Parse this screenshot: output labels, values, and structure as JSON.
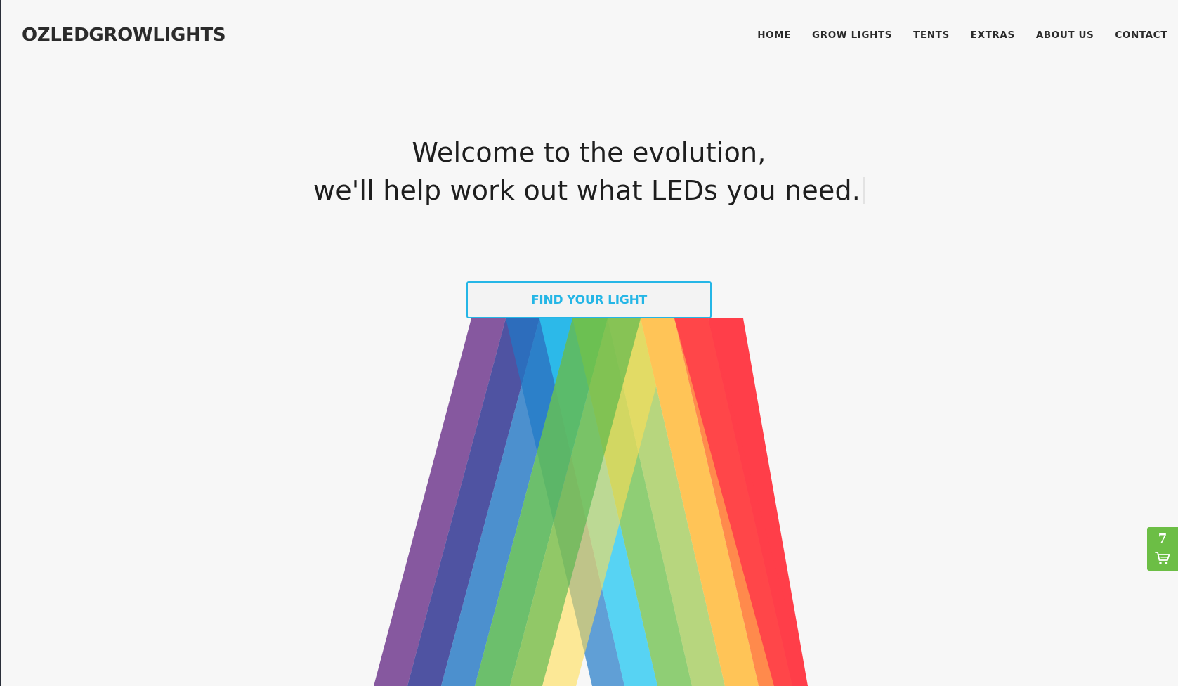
{
  "brand": {
    "name": "OZLEDGROWLIGHTS"
  },
  "nav": {
    "items": [
      {
        "label": "HOME"
      },
      {
        "label": "GROW LIGHTS"
      },
      {
        "label": "TENTS"
      },
      {
        "label": "EXTRAS"
      },
      {
        "label": "ABOUT US"
      },
      {
        "label": "CONTACT"
      }
    ]
  },
  "hero": {
    "line1": "Welcome to the evolution,",
    "line2": "we'll help work out what LEDs you need."
  },
  "cta": {
    "label": "FIND YOUR LIGHT"
  },
  "cart": {
    "count": "7",
    "icon": "cart-icon"
  },
  "colors": {
    "accent": "#25b6e6",
    "cart_green": "#6cbe45",
    "spectrum": [
      "#86589f",
      "#4f53a2",
      "#428acb",
      "#5cb85c",
      "#7fbf4d",
      "#ffc457",
      "#ff8a4c",
      "#ff3e49"
    ]
  }
}
